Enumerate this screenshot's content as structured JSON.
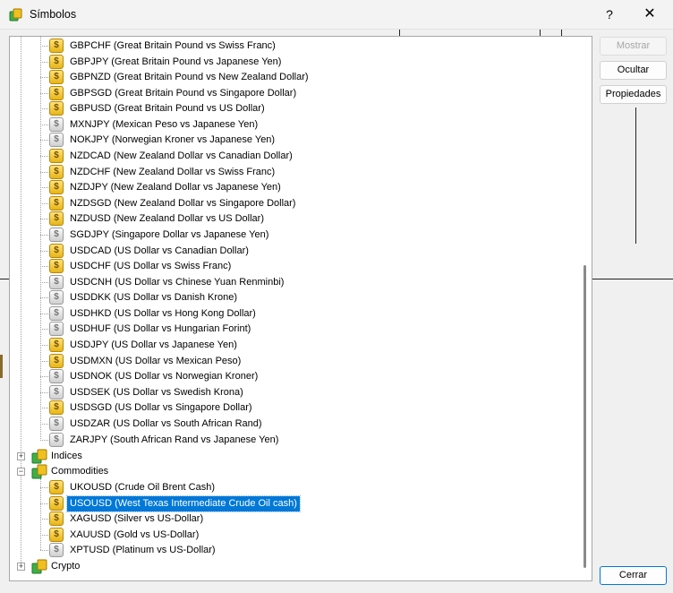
{
  "window": {
    "title": "Símbolos",
    "help": "?",
    "close": "✕"
  },
  "buttons": {
    "show": "Mostrar",
    "hide": "Ocultar",
    "properties": "Propiedades",
    "close": "Cerrar"
  },
  "colors": {
    "selection": "#0078d7",
    "enabled_coin": "#f0c020",
    "disabled_coin": "#c8c8c8"
  },
  "symbols": [
    {
      "label": "GBPCHF  (Great Britain Pound vs Swiss Franc)",
      "state": "gold"
    },
    {
      "label": "GBPJPY  (Great Britain Pound vs Japanese Yen)",
      "state": "gold"
    },
    {
      "label": "GBPNZD  (Great Britain Pound vs New Zealand Dollar)",
      "state": "gold"
    },
    {
      "label": "GBPSGD  (Great Britain Pound vs Singapore Dollar)",
      "state": "gold"
    },
    {
      "label": "GBPUSD  (Great Britain Pound vs US Dollar)",
      "state": "gold"
    },
    {
      "label": "MXNJPY  (Mexican Peso vs Japanese Yen)",
      "state": "gray"
    },
    {
      "label": "NOKJPY  (Norwegian Kroner vs Japanese Yen)",
      "state": "gray"
    },
    {
      "label": "NZDCAD  (New Zealand Dollar vs Canadian Dollar)",
      "state": "gold"
    },
    {
      "label": "NZDCHF  (New Zealand Dollar vs Swiss Franc)",
      "state": "gold"
    },
    {
      "label": "NZDJPY  (New Zealand Dollar vs Japanese Yen)",
      "state": "gold"
    },
    {
      "label": "NZDSGD  (New Zealand Dollar vs Singapore Dollar)",
      "state": "gold"
    },
    {
      "label": "NZDUSD  (New Zealand Dollar vs US Dollar)",
      "state": "gold"
    },
    {
      "label": "SGDJPY  (Singapore Dollar vs Japanese Yen)",
      "state": "gray"
    },
    {
      "label": "USDCAD  (US Dollar vs Canadian Dollar)",
      "state": "gold"
    },
    {
      "label": "USDCHF  (US Dollar vs Swiss Franc)",
      "state": "gold"
    },
    {
      "label": "USDCNH  (US Dollar vs Chinese Yuan Renminbi)",
      "state": "gray"
    },
    {
      "label": "USDDKK  (US Dollar vs Danish Krone)",
      "state": "gray"
    },
    {
      "label": "USDHKD  (US Dollar vs Hong Kong Dollar)",
      "state": "gray"
    },
    {
      "label": "USDHUF  (US Dollar vs Hungarian Forint)",
      "state": "gray"
    },
    {
      "label": "USDJPY  (US Dollar vs Japanese Yen)",
      "state": "gold"
    },
    {
      "label": "USDMXN  (US Dollar vs Mexican Peso)",
      "state": "gold"
    },
    {
      "label": "USDNOK  (US Dollar vs Norwegian Kroner)",
      "state": "gray"
    },
    {
      "label": "USDSEK  (US Dollar vs Swedish Krona)",
      "state": "gray"
    },
    {
      "label": "USDSGD  (US Dollar vs Singapore Dollar)",
      "state": "gold"
    },
    {
      "label": "USDZAR  (US Dollar vs South African Rand)",
      "state": "gray"
    },
    {
      "label": "ZARJPY  (South African Rand vs Japanese Yen)",
      "state": "gray"
    }
  ],
  "folders": {
    "indices": {
      "label": "Indices",
      "expander": "+"
    },
    "commodities": {
      "label": "Commodities",
      "expander": "−"
    },
    "crypto": {
      "label": "Crypto",
      "expander": "+"
    }
  },
  "commodities": [
    {
      "label": "UKOUSD  (Crude Oil Brent Cash)",
      "state": "gold",
      "selected": false
    },
    {
      "label": "USOUSD  (West Texas Intermediate Crude Oil cash)",
      "state": "gold",
      "selected": true
    },
    {
      "label": "XAGUSD  (Silver vs US-Dollar)",
      "state": "gold",
      "selected": false
    },
    {
      "label": "XAUUSD  (Gold vs US-Dollar)",
      "state": "gold",
      "selected": false
    },
    {
      "label": "XPTUSD  (Platinum vs US-Dollar)",
      "state": "gray",
      "selected": false
    }
  ]
}
